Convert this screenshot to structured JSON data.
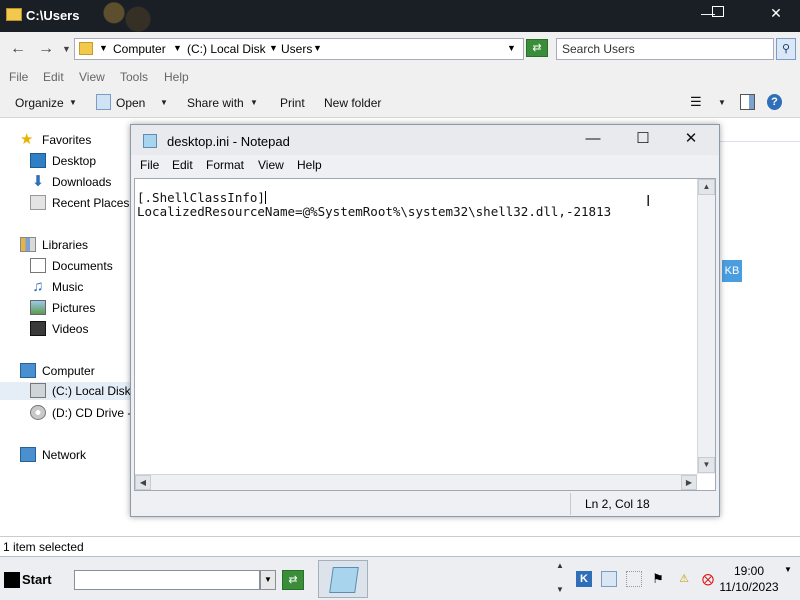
{
  "explorer": {
    "title": "C:\\Users",
    "address": {
      "crumbs": [
        "Computer",
        "(C:) Local Disk",
        "Users"
      ]
    },
    "search_placeholder": "Search Users",
    "menu": [
      "File",
      "Edit",
      "View",
      "Tools",
      "Help"
    ],
    "toolbar": {
      "organize": "Organize",
      "open": "Open",
      "share_with": "Share with",
      "print": "Print",
      "new_folder": "New folder"
    },
    "sidebar": {
      "favorites": "Favorites",
      "desktop": "Desktop",
      "downloads": "Downloads",
      "recent_places": "Recent Places",
      "libraries": "Libraries",
      "documents": "Documents",
      "music": "Music",
      "pictures": "Pictures",
      "videos": "Videos",
      "computer": "Computer",
      "local_disk": "(C:) Local Disk",
      "cd_drive": "(D:) CD Drive -",
      "network": "Network"
    },
    "kb_badge": "KB",
    "status": "1 item selected"
  },
  "notepad": {
    "title": "desktop.ini - Notepad",
    "menu": [
      "File",
      "Edit",
      "Format",
      "View",
      "Help"
    ],
    "text_line1": "[.ShellClassInfo]",
    "text_line2": "LocalizedResourceName=@%SystemRoot%\\system32\\shell32.dll,-21813",
    "status_position": "Ln 2, Col 18"
  },
  "taskbar": {
    "start_label": "Start",
    "clock_time": "19:00",
    "clock_date": "11/10/2023"
  },
  "colors": {
    "titlebar": "#1a1f26",
    "accent_green": "#3a8e3a",
    "kb_blue": "#4a9ee0"
  }
}
